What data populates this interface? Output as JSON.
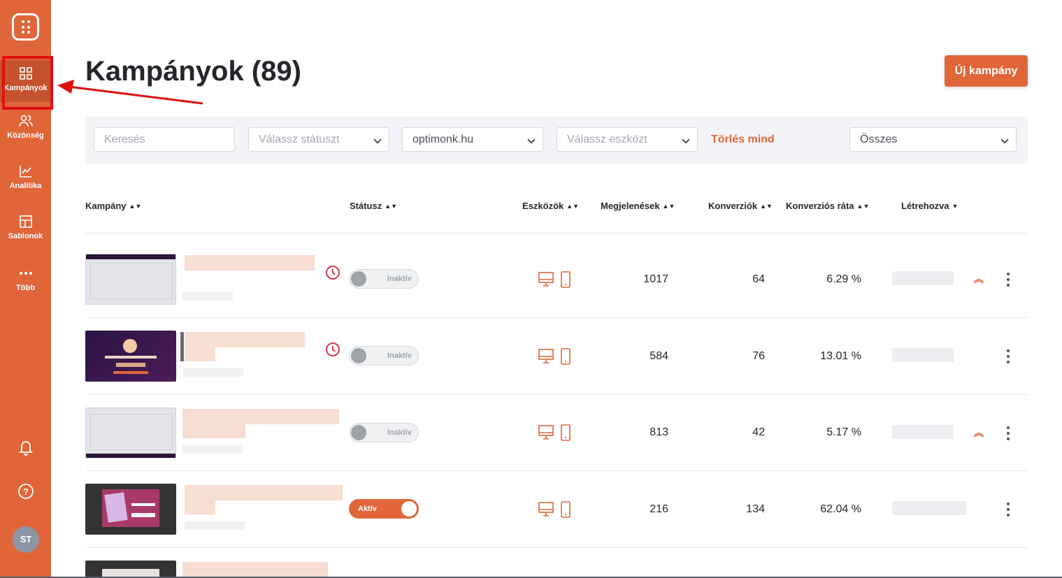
{
  "sidebar": {
    "items": [
      {
        "label": "Kampányok",
        "icon": "grid-icon"
      },
      {
        "label": "Közönség",
        "icon": "users-icon"
      },
      {
        "label": "Analitika",
        "icon": "chart-icon"
      },
      {
        "label": "Sablonok",
        "icon": "layout-icon"
      },
      {
        "label": "Több",
        "icon": "more-dots-icon"
      }
    ],
    "avatar": "ST"
  },
  "page": {
    "title": "Kampányok (89)",
    "new_button": "Új kampány"
  },
  "filters": {
    "search_placeholder": "Keresés",
    "status_placeholder": "Válassz státuszt",
    "domain_value": "optimonk.hu",
    "device_placeholder": "Válassz eszközt",
    "clear_all": "Törlés mind",
    "scope_value": "Összes"
  },
  "table": {
    "headers": {
      "campaign": "Kampány",
      "status": "Státusz",
      "devices": "Eszközök",
      "impressions": "Megjelenések",
      "conversions": "Konverziók",
      "conversion_rate": "Konverziós ráta",
      "created": "Létrehozva"
    },
    "rows": [
      {
        "status": "Inaktív",
        "active": false,
        "impressions": "1017",
        "conversions": "64",
        "rate": "6.29 %"
      },
      {
        "status": "Inaktív",
        "active": false,
        "impressions": "584",
        "conversions": "76",
        "rate": "13.01 %"
      },
      {
        "status": "Inaktív",
        "active": false,
        "impressions": "813",
        "conversions": "42",
        "rate": "5.17 %"
      },
      {
        "status": "Aktív",
        "active": true,
        "impressions": "216",
        "conversions": "134",
        "rate": "62.04 %"
      }
    ]
  },
  "colors": {
    "accent": "#e0663a",
    "highlight": "#e01010"
  }
}
